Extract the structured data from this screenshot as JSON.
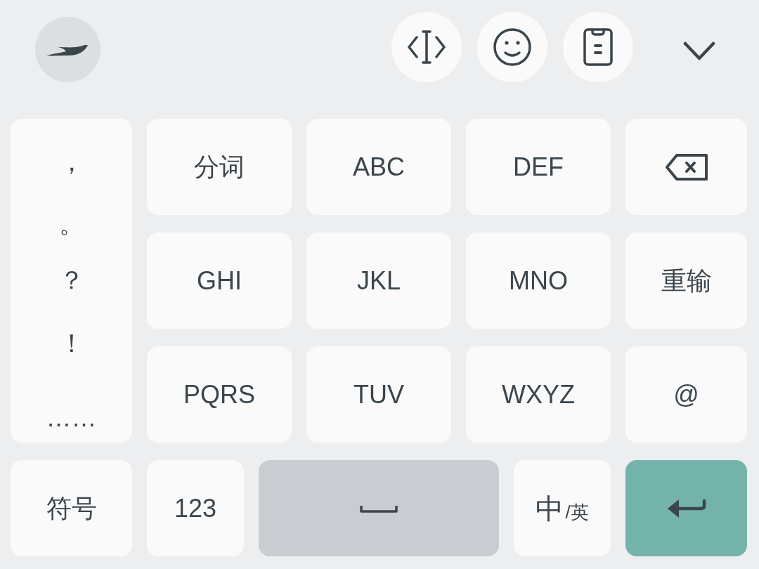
{
  "punctuation_column": [
    "，",
    "。",
    "？",
    "！",
    "……"
  ],
  "key_rows": [
    [
      {
        "kind": "text",
        "label": "分词"
      },
      {
        "kind": "text",
        "label": "ABC"
      },
      {
        "kind": "text",
        "label": "DEF"
      },
      {
        "kind": "backspace"
      }
    ],
    [
      {
        "kind": "text",
        "label": "GHI"
      },
      {
        "kind": "text",
        "label": "JKL"
      },
      {
        "kind": "text",
        "label": "MNO"
      },
      {
        "kind": "text",
        "label": "重输"
      }
    ],
    [
      {
        "kind": "text",
        "label": "PQRS"
      },
      {
        "kind": "text",
        "label": "TUV"
      },
      {
        "kind": "text",
        "label": "WXYZ"
      },
      {
        "kind": "text",
        "label": "@"
      }
    ]
  ],
  "bottom_row": [
    {
      "kind": "text",
      "label": "符号"
    },
    {
      "kind": "text",
      "label": "123"
    },
    {
      "kind": "space"
    },
    {
      "kind": "language",
      "primary": "中",
      "secondary": "/英"
    },
    {
      "kind": "enter"
    }
  ]
}
